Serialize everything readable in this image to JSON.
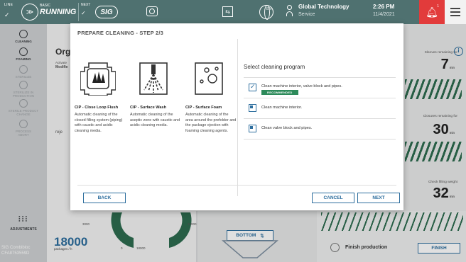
{
  "topbar": {
    "live": "LINE",
    "mode": "BASIC",
    "state": "RUNNING",
    "next": "NEXT",
    "sig": "SIG",
    "globe_lang": "EN",
    "user_name": "Global Technology",
    "user_role": "Service",
    "time": "2:26 PM",
    "date": "11/4/2021",
    "alarm_count": "1"
  },
  "sidebar": {
    "items": [
      {
        "label": "CLEANING"
      },
      {
        "label": "FOAMING"
      },
      {
        "label": "STERILIZE"
      },
      {
        "label": "STERILIZE IN PRODUCTION"
      },
      {
        "label": "STERILE PRODUCT CHANGE"
      },
      {
        "label": "PROCESS ABORT"
      }
    ],
    "adjustments": "ADJUSTMENTS",
    "footer_line1": "SIG Combibloc",
    "footer_line2": "CFA8753559D"
  },
  "background": {
    "panel_heading": "Org",
    "activate": "Activate",
    "modify": "Modifie",
    "reject": "reje",
    "sleeves_label": "Sleeves remaining for",
    "sleeves_value": "7",
    "closures_label": "Closures remaining for",
    "closures_value": "30",
    "check_label": "Check filling weight",
    "check_value": "32",
    "unit_min": "min",
    "rate_value": "18000",
    "rate_unit": "packages / h",
    "gauge_labels": [
      "3000",
      "0",
      "18000",
      "15000"
    ],
    "bottom_button": "BOTTOM",
    "finish_production": "Finish production",
    "finish_button": "FINISH"
  },
  "modal": {
    "title": "PREPARE CLEANING - STEP 2/3",
    "cards": [
      {
        "title": "CIP - Close Loop Flush",
        "desc": "Automatic cleaning of the closed filling system (piping) with caustic and acidic cleaning media."
      },
      {
        "title": "CIP - Surface Wash",
        "desc": "Automatic cleaning of the aseptic zone with caustic and acidic cleaning media."
      },
      {
        "title": "CIP - Surface Foam",
        "desc": "Automatic cleaning of the area around the prefolder and the package ejection with foaming cleaning agents."
      }
    ],
    "program_title": "Select cleaning program",
    "programs": [
      {
        "label": "Clean machine interior, valve block and pipes.",
        "badge": "RECOMMENDED",
        "checked": true
      },
      {
        "label": "Clean machine interior.",
        "checked": false
      },
      {
        "label": "Clean valve block and pipes.",
        "checked": false
      }
    ],
    "back": "BACK",
    "cancel": "CANCEL",
    "next": "NEXT"
  },
  "colors": {
    "topbar": "#4f7170",
    "accent": "#2d6e9e",
    "alarm": "#e23b3b",
    "recommended": "#2d8a5a",
    "stripes": "#2d6b4f"
  }
}
